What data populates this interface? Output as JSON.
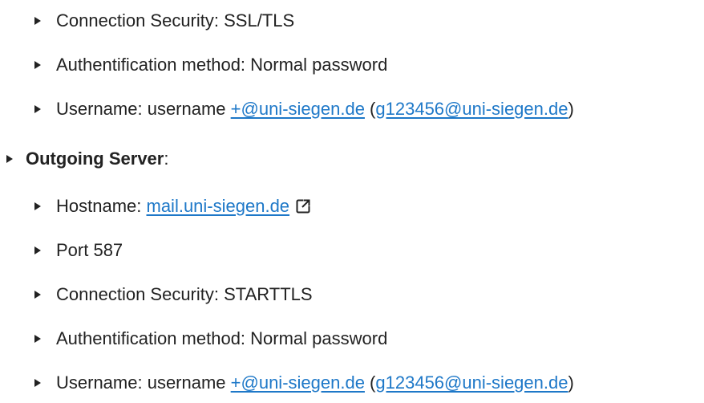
{
  "incoming_continued": {
    "connection_security": "Connection Security: SSL/TLS",
    "auth_method": "Authentification method: Normal password",
    "username_prefix": "Username: username ",
    "username_link": "+@uni-siegen.de",
    "username_open_paren": " (",
    "username_example_link": "g123456@uni-siegen.de",
    "username_close_paren": ")"
  },
  "outgoing": {
    "heading": "Outgoing Server",
    "heading_suffix": ":",
    "hostname_prefix": "Hostname: ",
    "hostname_link": "mail.uni-siegen.de",
    "hostname_icon": "external-link-icon",
    "port": "Port 587",
    "connection_security": "Connection Security: STARTTLS",
    "auth_method": "Authentification method: Normal password",
    "username_prefix": "Username: username ",
    "username_link": "+@uni-siegen.de",
    "username_open_paren": " (",
    "username_example_link": "g123456@uni-siegen.de",
    "username_close_paren": ")"
  },
  "colors": {
    "text": "#222222",
    "link": "#1e78c8"
  }
}
